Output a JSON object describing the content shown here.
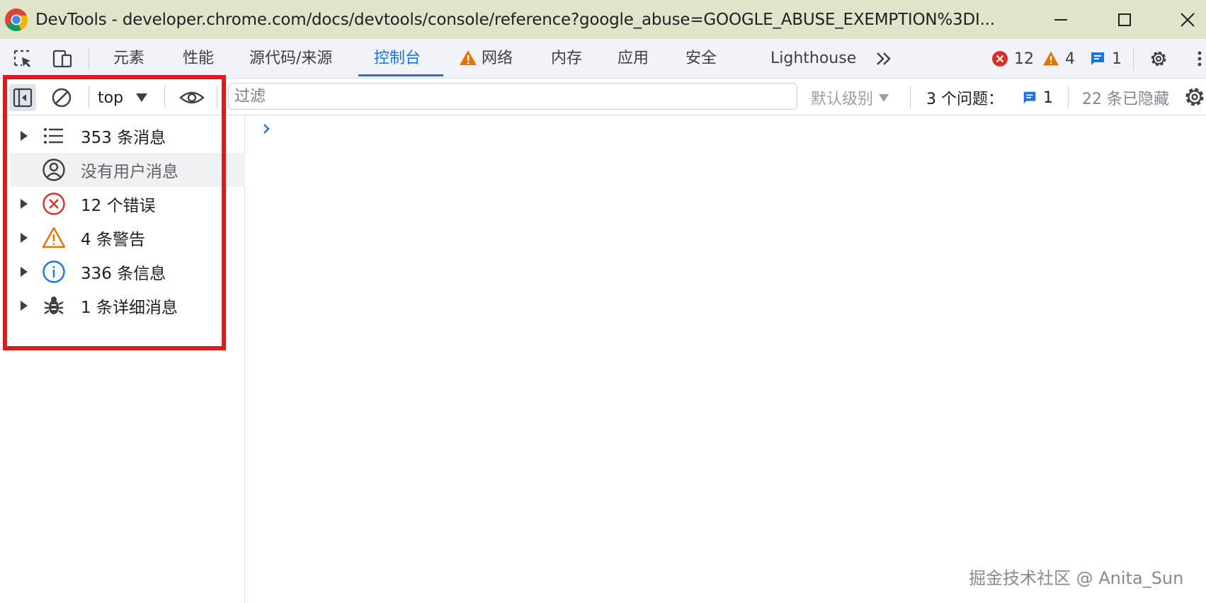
{
  "window": {
    "title": "DevTools - developer.chrome.com/docs/devtools/console/reference?google_abuse=GOOGLE_ABUSE_EXEMPTION%3DI..."
  },
  "tabs": [
    {
      "label": "元素"
    },
    {
      "label": "性能"
    },
    {
      "label": "源代码/来源"
    },
    {
      "label": "控制台",
      "active": true
    },
    {
      "label": "网络"
    },
    {
      "label": "内存"
    },
    {
      "label": "应用"
    },
    {
      "label": "安全"
    },
    {
      "label": "Lighthouse"
    }
  ],
  "counters": {
    "errors": "12",
    "warnings": "4",
    "issues": "1"
  },
  "toolbar": {
    "context": "top",
    "filter_placeholder": "过滤",
    "filter_value": "",
    "levels": "默认级别",
    "issues_label": "3 个问题：",
    "issues_count": "1",
    "hidden": "22 条已隐藏"
  },
  "sidebar": {
    "items": [
      {
        "label": "353 条消息",
        "icon": "list-icon",
        "expandable": true
      },
      {
        "label": "没有用户消息",
        "icon": "user-icon",
        "expandable": false,
        "selected": true
      },
      {
        "label": "12 个错误",
        "icon": "error-icon",
        "expandable": true
      },
      {
        "label": "4 条警告",
        "icon": "warning-icon",
        "expandable": true
      },
      {
        "label": "336 条信息",
        "icon": "info-icon",
        "expandable": true
      },
      {
        "label": "1 条详细消息",
        "icon": "bug-icon",
        "expandable": true
      }
    ]
  },
  "watermark": "掘金技术社区 @ Anita_Sun",
  "colors": {
    "accent": "#1a73e8",
    "error": "#d93025",
    "warning": "#e37400",
    "highlight_box": "#e0191b",
    "titlebar_bg": "#dfe5ca"
  }
}
